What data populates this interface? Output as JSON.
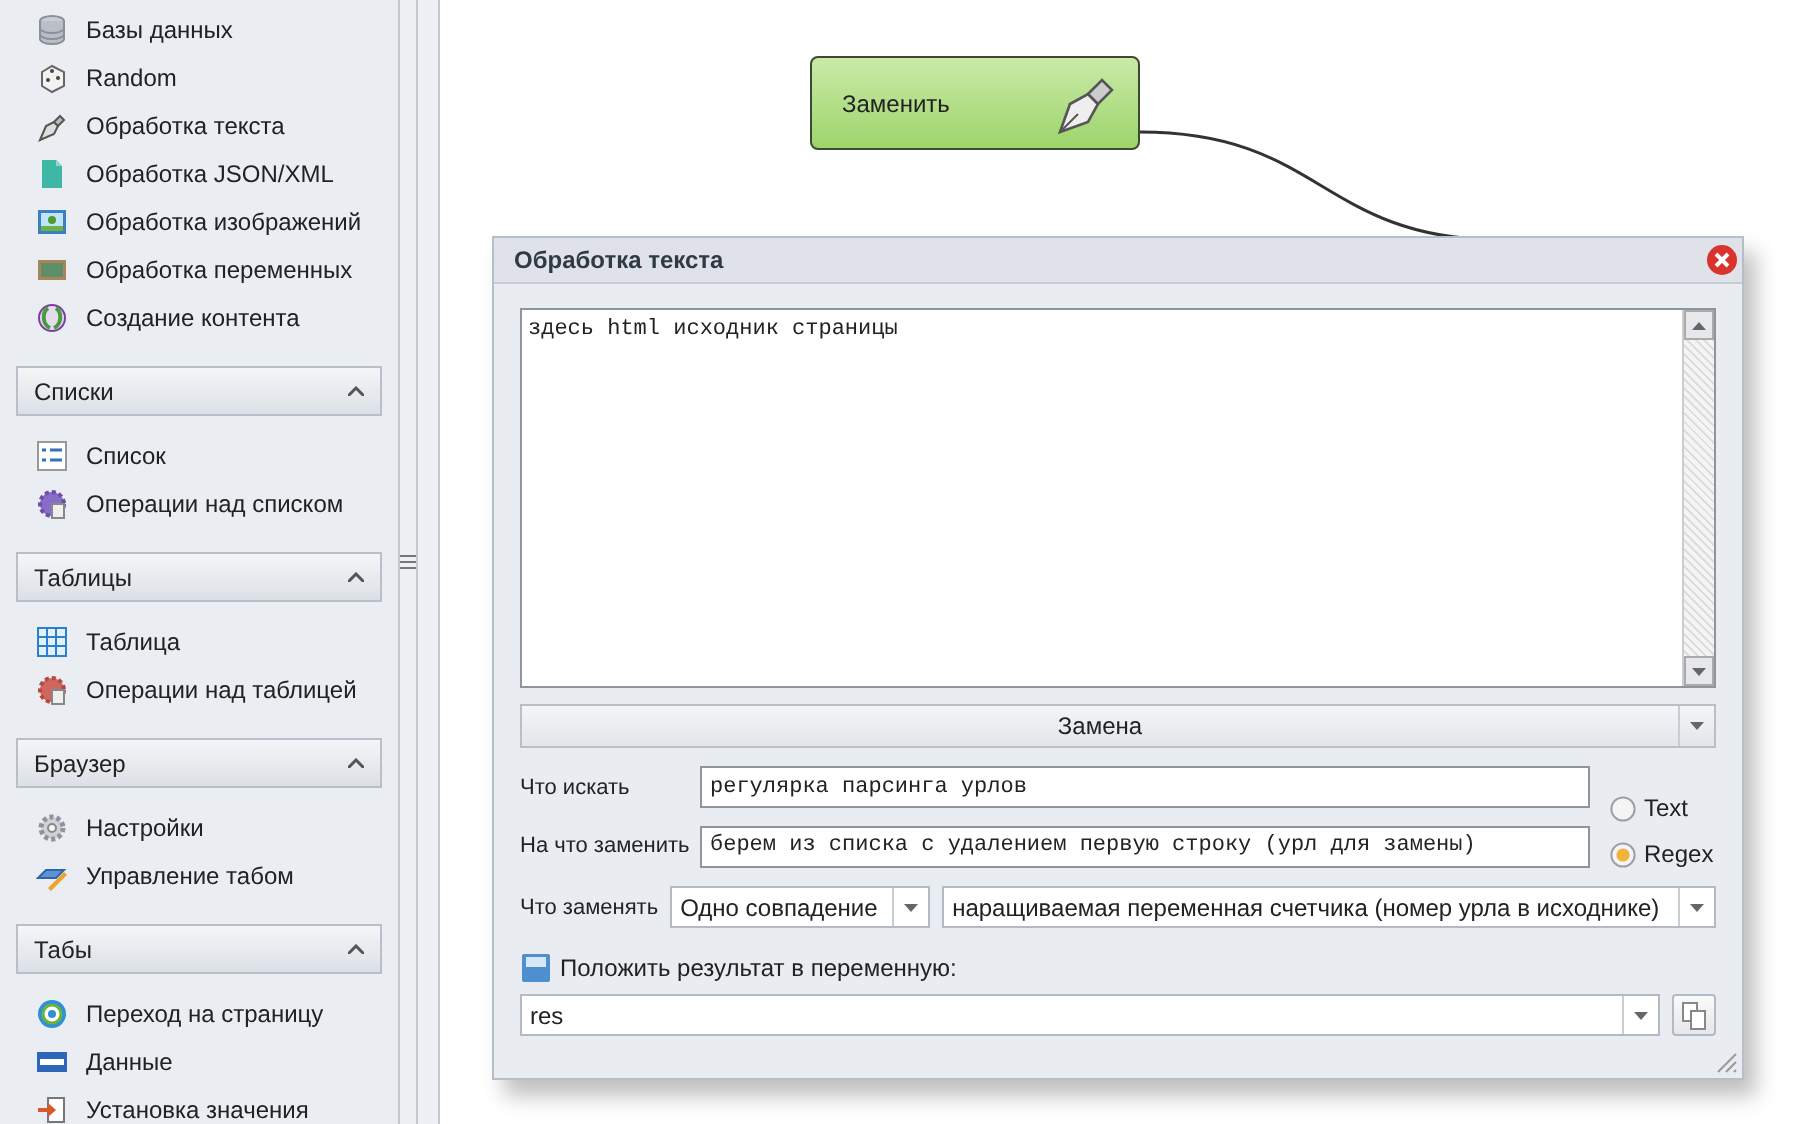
{
  "sidebar": {
    "groups": [
      {
        "items": [
          {
            "label": "Базы данных"
          },
          {
            "label": "Random"
          },
          {
            "label": "Обработка текста"
          },
          {
            "label": "Обработка JSON/XML"
          },
          {
            "label": "Обработка изображений"
          },
          {
            "label": "Обработка переменных"
          },
          {
            "label": "Создание контента"
          }
        ]
      },
      {
        "title": "Списки",
        "expanded": true,
        "items": [
          {
            "label": "Список"
          },
          {
            "label": "Операции над списком"
          }
        ]
      },
      {
        "title": "Таблицы",
        "expanded": true,
        "items": [
          {
            "label": "Таблица"
          },
          {
            "label": "Операции над таблицей"
          }
        ]
      },
      {
        "title": "Браузер",
        "expanded": true,
        "items": [
          {
            "label": "Настройки"
          },
          {
            "label": "Управление табом"
          }
        ]
      },
      {
        "title": "Табы",
        "expanded": true,
        "items": [
          {
            "label": "Переход на страницу"
          },
          {
            "label": "Данные"
          },
          {
            "label": "Установка значения"
          }
        ]
      }
    ]
  },
  "canvas": {
    "node": {
      "label": "Заменить"
    }
  },
  "dialog": {
    "title": "Обработка текста",
    "source_text": "здесь html исходник страницы",
    "mode": "Замена",
    "search_label": "Что искать",
    "search_value": "регулярка парсинга урлов",
    "replace_label": "На что заменить",
    "replace_value": "берем из списка с удалением первую строку (урл для замены)",
    "match_types": [
      {
        "label": "Text",
        "selected": false
      },
      {
        "label": "Regex",
        "selected": true
      }
    ],
    "scope_label": "Что заменять",
    "scope_value": "Одно совпадение",
    "counter_value": "наращиваемая переменная счетчика (номер урла в исходнике)",
    "result_label": "Положить результат в переменную:",
    "result_value": "res"
  }
}
